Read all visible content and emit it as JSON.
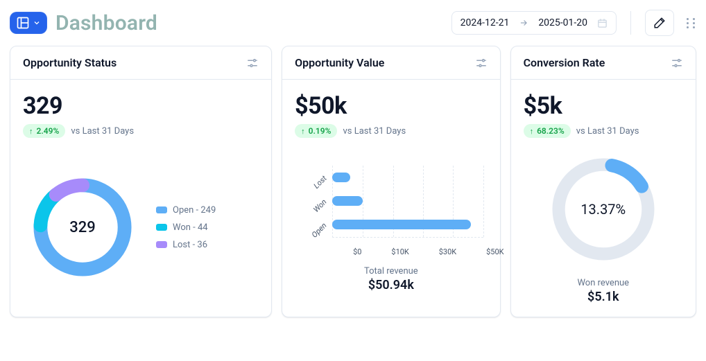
{
  "header": {
    "title": "Dashboard",
    "date_start": "2024-12-21",
    "date_end": "2025-01-20",
    "compare_label": "vs Last 31 Days"
  },
  "cards": {
    "status": {
      "title": "Opportunity Status",
      "value": "329",
      "delta": "2.49%",
      "donut_center": "329",
      "legend": {
        "open": "Open - 249",
        "won": "Won - 44",
        "lost": "Lost - 36"
      }
    },
    "value": {
      "title": "Opportunity Value",
      "value": "$50k",
      "delta": "0.19%",
      "footer_caption": "Total revenue",
      "footer_value": "$50.94k",
      "ylabels": {
        "lost": "Lost",
        "won": "Won",
        "open": "Open"
      },
      "xlabels": {
        "t0": "$0",
        "t1": "$10K",
        "t2": "$30K",
        "t3": "$50K"
      }
    },
    "conversion": {
      "title": "Conversion Rate",
      "value": "$5k",
      "delta": "68.23%",
      "gauge_center": "13.37%",
      "footer_caption": "Won revenue",
      "footer_value": "$5.1k"
    }
  },
  "colors": {
    "open": "#5eaef6",
    "won": "#0bc5ea",
    "lost": "#a78bfa"
  },
  "chart_data": [
    {
      "type": "pie",
      "title": "Opportunity Status",
      "categories": [
        "Open",
        "Won",
        "Lost"
      ],
      "values": [
        249,
        44,
        36
      ],
      "total": 329
    },
    {
      "type": "bar",
      "orientation": "horizontal",
      "title": "Opportunity Value",
      "categories": [
        "Lost",
        "Won",
        "Open"
      ],
      "values": [
        6,
        10,
        50
      ],
      "unit": "thousand_usd",
      "xlabel": "",
      "ylabel": "",
      "xlim": [
        0,
        55
      ],
      "total": 50.94
    },
    {
      "type": "pie",
      "title": "Conversion Rate",
      "categories": [
        "Won",
        "Remaining"
      ],
      "values": [
        13.37,
        86.63
      ],
      "unit": "percent"
    }
  ]
}
